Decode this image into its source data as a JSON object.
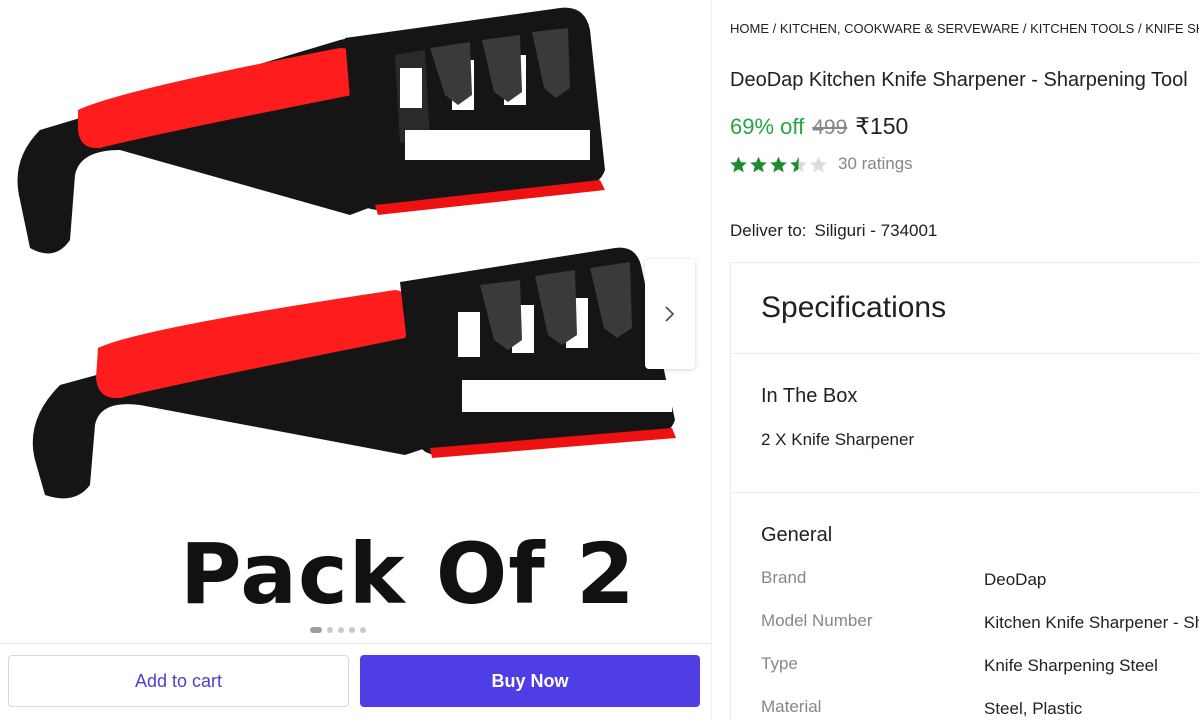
{
  "gallery": {
    "pack_label": "Pack Of 2",
    "dots_total": 5,
    "dots_active": 1,
    "colors": {
      "grip": "#ff1a1a",
      "body": "#111111"
    }
  },
  "actions": {
    "add_to_cart": "Add to cart",
    "buy_now": "Buy Now"
  },
  "breadcrumb": [
    "HOME",
    "KITCHEN, COOKWARE & SERVEWARE",
    "KITCHEN TOOLS",
    "KNIFE SHARPENERS"
  ],
  "product": {
    "title": "DeoDap Kitchen Knife Sharpener - Sharpening Tool",
    "discount": "69% off",
    "mrp": "499",
    "price": "₹150",
    "rating": 3.5,
    "ratings_count": "30 ratings"
  },
  "delivery": {
    "label": "Deliver to:",
    "location": "Siliguri - 734001"
  },
  "specifications": {
    "title": "Specifications",
    "in_the_box": {
      "title": "In The Box",
      "item": "2 X Knife Sharpener"
    },
    "general": {
      "title": "General",
      "rows": [
        {
          "key": "Brand",
          "value": "DeoDap"
        },
        {
          "key": "Model Number",
          "value": "Kitchen Knife Sharpener - Sharpening Tool"
        },
        {
          "key": "Type",
          "value": "Knife Sharpening Steel"
        },
        {
          "key": "Material",
          "value": "Steel, Plastic"
        }
      ]
    }
  },
  "colors": {
    "discount_green": "#26a541",
    "star_green": "#1e8c2e",
    "buy_button": "#4f3ee6",
    "cart_text": "#4b3fce"
  }
}
